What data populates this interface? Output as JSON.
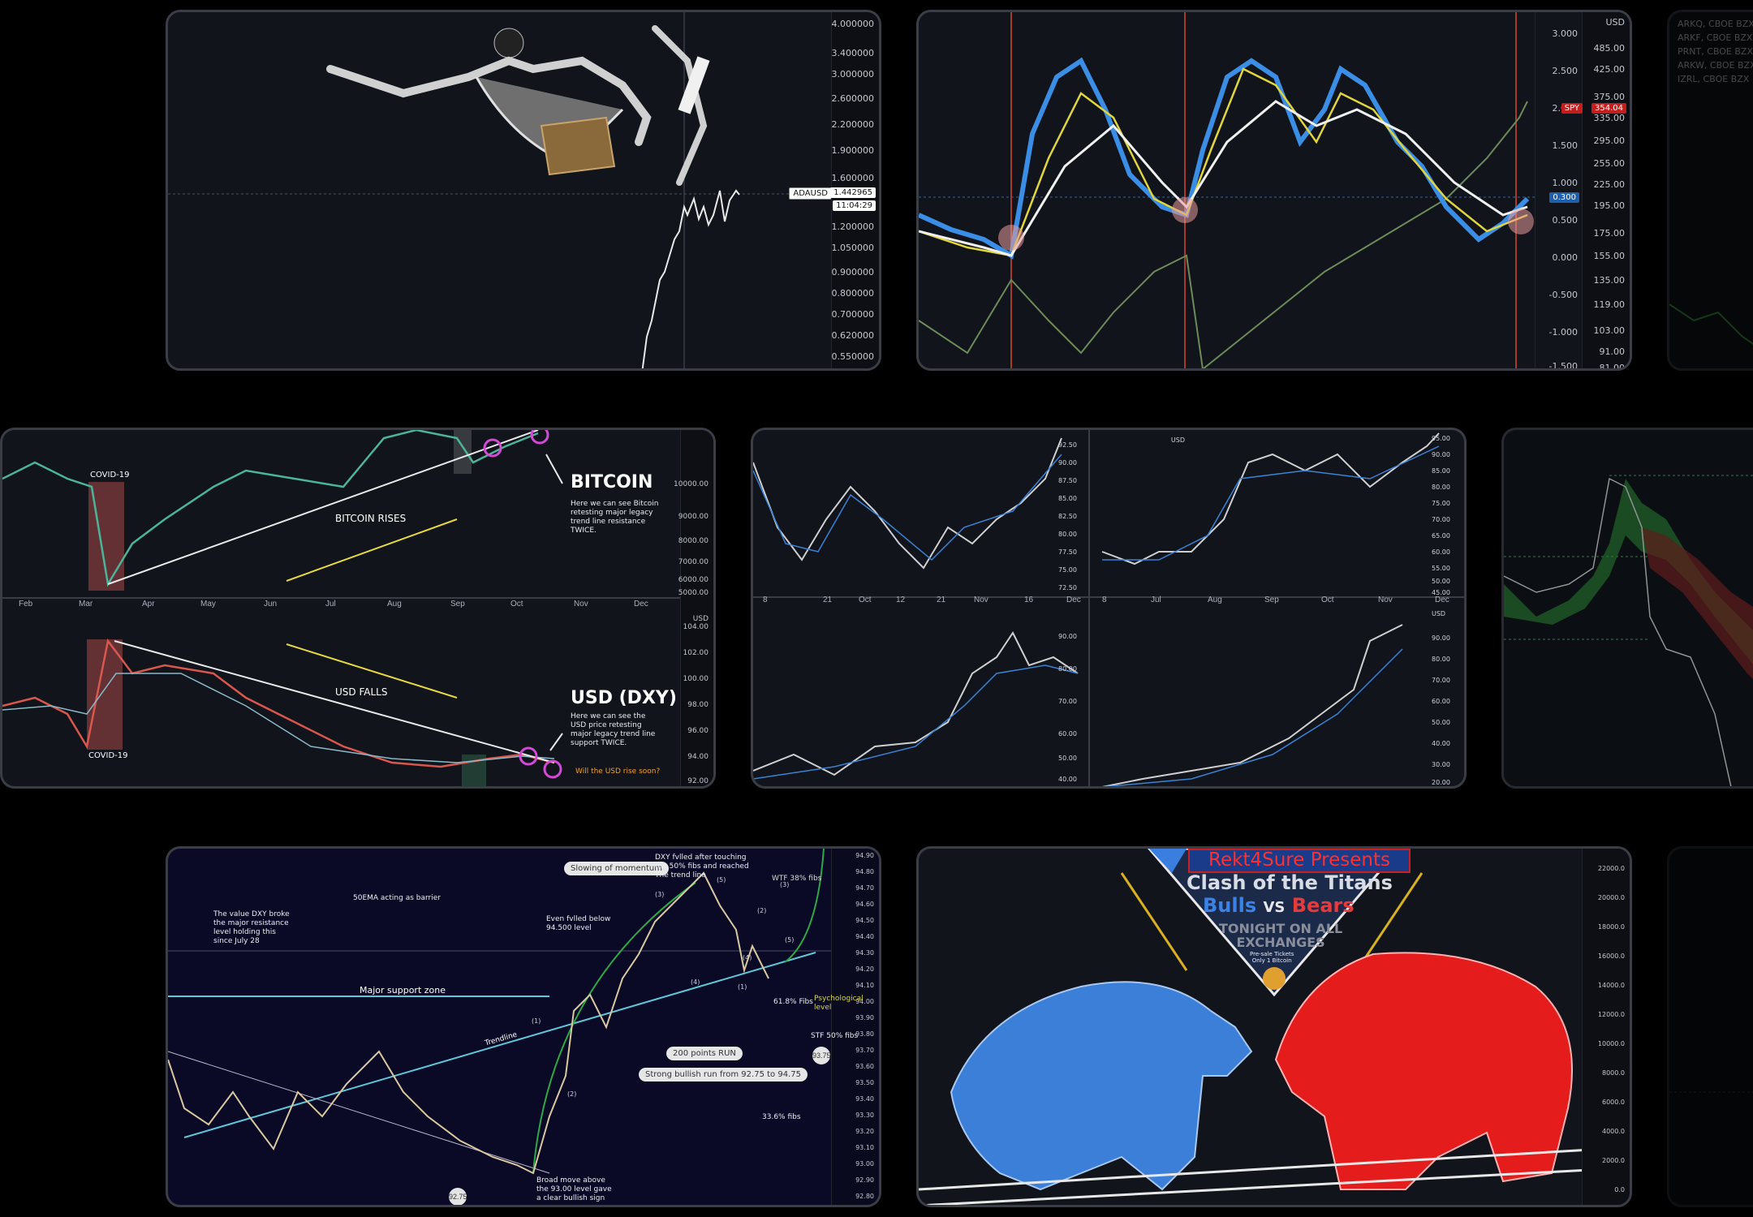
{
  "panels": {
    "ada": {
      "ticker": "ADAUSD",
      "price": "1.442965",
      "timer": "11:04:29",
      "axis": [
        "4.000000",
        "3.400000",
        "3.000000",
        "2.600000",
        "2.200000",
        "1.900000",
        "1.600000",
        "1.200000",
        "1.050000",
        "0.900000",
        "0.800000",
        "0.700000",
        "0.620000",
        "0.550000"
      ]
    },
    "spy": {
      "axis_outer": [
        "USD",
        "485.00",
        "425.00",
        "375.00",
        "335.00",
        "295.00",
        "255.00",
        "225.00",
        "195.00",
        "175.00",
        "155.00",
        "135.00",
        "119.00",
        "103.00",
        "91.00",
        "81.00"
      ],
      "axis_inner": [
        "3.000",
        "2.500",
        "2.000",
        "1.500",
        "1.000",
        "0.500",
        "0.000",
        "-0.500",
        "-1.000",
        "-1.500"
      ],
      "tag_spy": "SPY",
      "tag_spy_val": "354.04",
      "tag_blue": "0.300"
    },
    "watch": {
      "items": [
        "ARKQ, CBOE BZX",
        "ARKF, CBOE BZX",
        "PRNT, CBOE BZX",
        "ARKW, CBOE BZX",
        "IZRL, CBOE BZX"
      ]
    },
    "btc_dxy": {
      "top_months": [
        "Feb",
        "Mar",
        "Apr",
        "May",
        "Jun",
        "Jul",
        "Aug",
        "Sep",
        "Oct",
        "Nov",
        "Dec"
      ],
      "top_axis": [
        "10000.00",
        "9000.00",
        "8000.00",
        "7000.00",
        "6000.00",
        "5000.00"
      ],
      "bottom_axis": [
        "USD",
        "102.00",
        "100.00",
        "98.00",
        "96.00",
        "94.00",
        "92.00"
      ],
      "bottom_axis_currency": "USD",
      "bottom_axis_code": "104.00",
      "covid_top": "COVID-19",
      "covid_bottom": "COVID-19",
      "bitcoin_rises": "BITCOIN RISES",
      "bitcoin_title": "BITCOIN",
      "bitcoin_desc": "Here we can see Bitcoin\nretesting major legacy\ntrend line resistance\nTWICE.",
      "usd_falls": "USD FALLS",
      "usd_title": "USD (DXY)",
      "usd_desc": "Here we can see the\nUSD price retesting\nmajor legacy trend line\nsupport TWICE.",
      "usd_question": "Will the USD rise soon?"
    },
    "multi": {
      "tl_months": [
        "8",
        "21",
        "Oct",
        "12",
        "21",
        "Nov",
        "16",
        "Dec"
      ],
      "tr_months": [
        "8",
        "Jul",
        "Aug",
        "Sep",
        "Oct",
        "Nov",
        "Dec"
      ],
      "tl_axis": [
        "92.50",
        "90.00",
        "87.50",
        "85.00",
        "82.50",
        "80.00",
        "77.50",
        "75.00",
        "72.50"
      ],
      "tr_axis": [
        "95.00",
        "90.00",
        "85.00",
        "80.00",
        "75.00",
        "70.00",
        "65.00",
        "60.00",
        "55.00",
        "50.00",
        "45.00"
      ],
      "tr_axis_unit": "USD",
      "bl_axis": [
        "90.00",
        "80.00",
        "70.00",
        "60.00",
        "50.00",
        "40.00"
      ],
      "br_axis": [
        "USD",
        "90.00",
        "80.00",
        "70.00",
        "60.00",
        "50.00",
        "40.00",
        "30.00",
        "20.00"
      ]
    },
    "dxy_wave": {
      "axis": [
        "94.90",
        "94.80",
        "94.70",
        "94.60",
        "94.50",
        "94.40",
        "94.30",
        "94.20",
        "94.10",
        "94.00",
        "93.90",
        "93.80",
        "93.70",
        "93.60",
        "93.50",
        "93.40",
        "93.30",
        "93.20",
        "93.10",
        "93.00",
        "92.90",
        "92.80"
      ],
      "note_top_left": "The  value DXY broke\nthe major resistance\nlevel holding this\nsince July 28",
      "note_50ema": "50EMA acting as barrier",
      "note_slowing": "Slowing of momentum",
      "note_dxy": "DXY fvlled after touching\nthe 50% fibs and reached\nThe trend line",
      "note_even": "Even fvlled below\n94.500 level",
      "note_support": "Major support zone",
      "note_trendline": "Trendline",
      "note_run": "200 points RUN",
      "note_strong": "Strong bullish run from 92.75 to 94.75",
      "note_broad": "Broad move  above\nthe 93.00 level gave\na clear bullish sign",
      "note_wtf": "WTF 38% fibs",
      "note_psych": "Psychological level",
      "note_fibs61": "61.8% Fibs",
      "note_fibs50": "STF 50% fibs",
      "note_fibs33": "33.6% fibs",
      "bubble_low": "92.75",
      "bubble_high": "93.75",
      "waves": [
        "(1)",
        "(2)",
        "(3)",
        "(4)",
        "(5)",
        "(1)",
        "(2)",
        "(3)",
        "(4)",
        "(5)"
      ]
    },
    "poster": {
      "banner": "Rekt4Sure Presents",
      "title": "Clash of the Titans",
      "bulls": "Bulls",
      "vs": "VS",
      "bears": "Bears",
      "tonight": "TONIGHT ON ALL\nEXCHANGES",
      "tickets": "Pre-sale Tickets\nOnly 1 Bitcoin",
      "axis": [
        "22000.0",
        "20000.0",
        "18000.0",
        "16000.0",
        "14000.0",
        "12000.0",
        "10000.0",
        "8000.0",
        "6000.0",
        "4000.0",
        "2000.0",
        "0.0"
      ]
    }
  }
}
